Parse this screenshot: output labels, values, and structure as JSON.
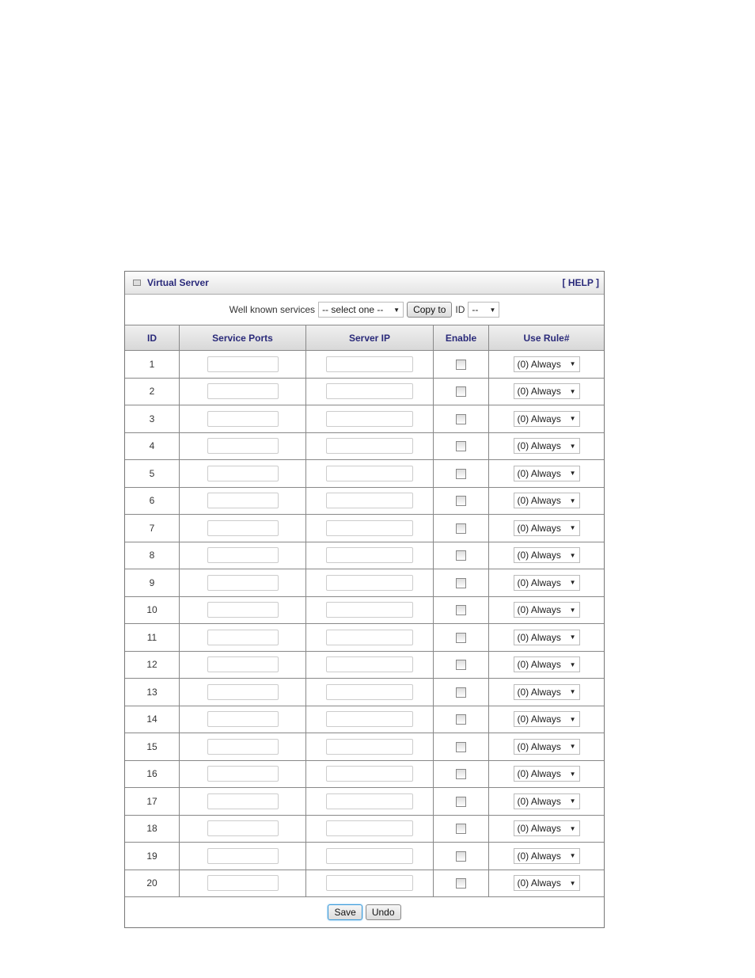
{
  "panel": {
    "title": "Virtual Server",
    "help": "[ HELP ]"
  },
  "services": {
    "label": "Well known services",
    "select_value": "-- select one --",
    "copy_button": "Copy to",
    "id_label": "ID",
    "id_value": "--"
  },
  "table": {
    "headers": [
      "ID",
      "Service Ports",
      "Server IP",
      "Enable",
      "Use Rule#"
    ],
    "rows": [
      {
        "id": "1",
        "ports": "",
        "ip": "",
        "enabled": false,
        "rule": "(0) Always"
      },
      {
        "id": "2",
        "ports": "",
        "ip": "",
        "enabled": false,
        "rule": "(0) Always"
      },
      {
        "id": "3",
        "ports": "",
        "ip": "",
        "enabled": false,
        "rule": "(0) Always"
      },
      {
        "id": "4",
        "ports": "",
        "ip": "",
        "enabled": false,
        "rule": "(0) Always"
      },
      {
        "id": "5",
        "ports": "",
        "ip": "",
        "enabled": false,
        "rule": "(0) Always"
      },
      {
        "id": "6",
        "ports": "",
        "ip": "",
        "enabled": false,
        "rule": "(0) Always"
      },
      {
        "id": "7",
        "ports": "",
        "ip": "",
        "enabled": false,
        "rule": "(0) Always"
      },
      {
        "id": "8",
        "ports": "",
        "ip": "",
        "enabled": false,
        "rule": "(0) Always"
      },
      {
        "id": "9",
        "ports": "",
        "ip": "",
        "enabled": false,
        "rule": "(0) Always"
      },
      {
        "id": "10",
        "ports": "",
        "ip": "",
        "enabled": false,
        "rule": "(0) Always"
      },
      {
        "id": "11",
        "ports": "",
        "ip": "",
        "enabled": false,
        "rule": "(0) Always"
      },
      {
        "id": "12",
        "ports": "",
        "ip": "",
        "enabled": false,
        "rule": "(0) Always"
      },
      {
        "id": "13",
        "ports": "",
        "ip": "",
        "enabled": false,
        "rule": "(0) Always"
      },
      {
        "id": "14",
        "ports": "",
        "ip": "",
        "enabled": false,
        "rule": "(0) Always"
      },
      {
        "id": "15",
        "ports": "",
        "ip": "",
        "enabled": false,
        "rule": "(0) Always"
      },
      {
        "id": "16",
        "ports": "",
        "ip": "",
        "enabled": false,
        "rule": "(0) Always"
      },
      {
        "id": "17",
        "ports": "",
        "ip": "",
        "enabled": false,
        "rule": "(0) Always"
      },
      {
        "id": "18",
        "ports": "",
        "ip": "",
        "enabled": false,
        "rule": "(0) Always"
      },
      {
        "id": "19",
        "ports": "",
        "ip": "",
        "enabled": false,
        "rule": "(0) Always"
      },
      {
        "id": "20",
        "ports": "",
        "ip": "",
        "enabled": false,
        "rule": "(0) Always"
      }
    ]
  },
  "footer": {
    "save": "Save",
    "undo": "Undo"
  }
}
